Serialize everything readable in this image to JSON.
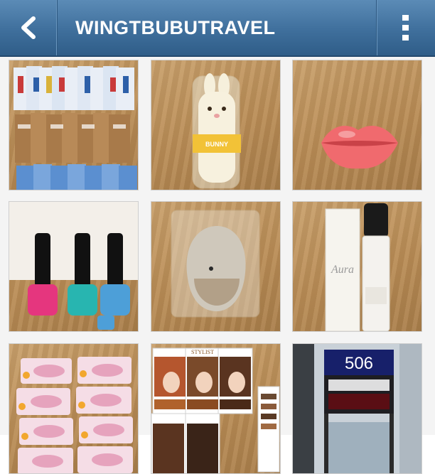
{
  "header": {
    "title": "WINGTBUBUTRAVEL",
    "back_icon": "chevron-left-icon",
    "menu_icon": "more-vertical-icon",
    "bar_color": "#3f6f9c"
  },
  "photos": [
    {
      "name": "photo-sheet-masks",
      "package_text": ""
    },
    {
      "name": "photo-bunny-hand-cream",
      "package_text": "BUNNY"
    },
    {
      "name": "photo-lip-balm",
      "package_text": ""
    },
    {
      "name": "photo-nail-polish",
      "package_text": ""
    },
    {
      "name": "photo-makeup-sponge",
      "package_text": ""
    },
    {
      "name": "photo-cc-cream",
      "package_text": "Aura"
    },
    {
      "name": "photo-lip-masks",
      "package_text": ""
    },
    {
      "name": "photo-hair-dye",
      "package_text": "STYLIST"
    },
    {
      "name": "photo-gate-sign",
      "package_text": "506"
    }
  ]
}
